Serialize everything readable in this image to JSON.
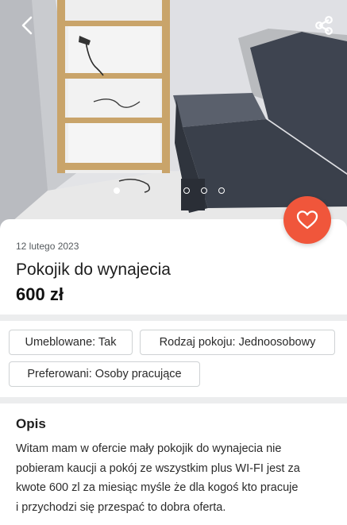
{
  "photo": {
    "gallery_total": 4,
    "gallery_active_index": 1
  },
  "listing": {
    "date": "12 lutego 2023",
    "title": "Pokojik do wynajecia",
    "price": "600 zł"
  },
  "tags": [
    {
      "label": "Umeblowane: Tak"
    },
    {
      "label": "Rodzaj pokoju: Jednoosobowy"
    },
    {
      "label": "Preferowani: Osoby pracujące"
    }
  ],
  "description": {
    "heading": "Opis",
    "lines": [
      "Witam mam w ofercie mały pokojik do wynajecia nie",
      "pobieram kaucji a pokój ze wszystkim plus WI-FI jest za",
      "kwote 600 zl za miesiąc myśle że dla kogoś kto pracuje",
      "i przychodzi się przespać to dobra oferta."
    ]
  },
  "icons": {
    "back": "chevron-left-icon",
    "share": "share-icon",
    "favorite": "heart-icon"
  },
  "colors": {
    "accent": "#f0563b",
    "sofa": "#3e4450",
    "shelf_wood": "#c9a46a"
  }
}
